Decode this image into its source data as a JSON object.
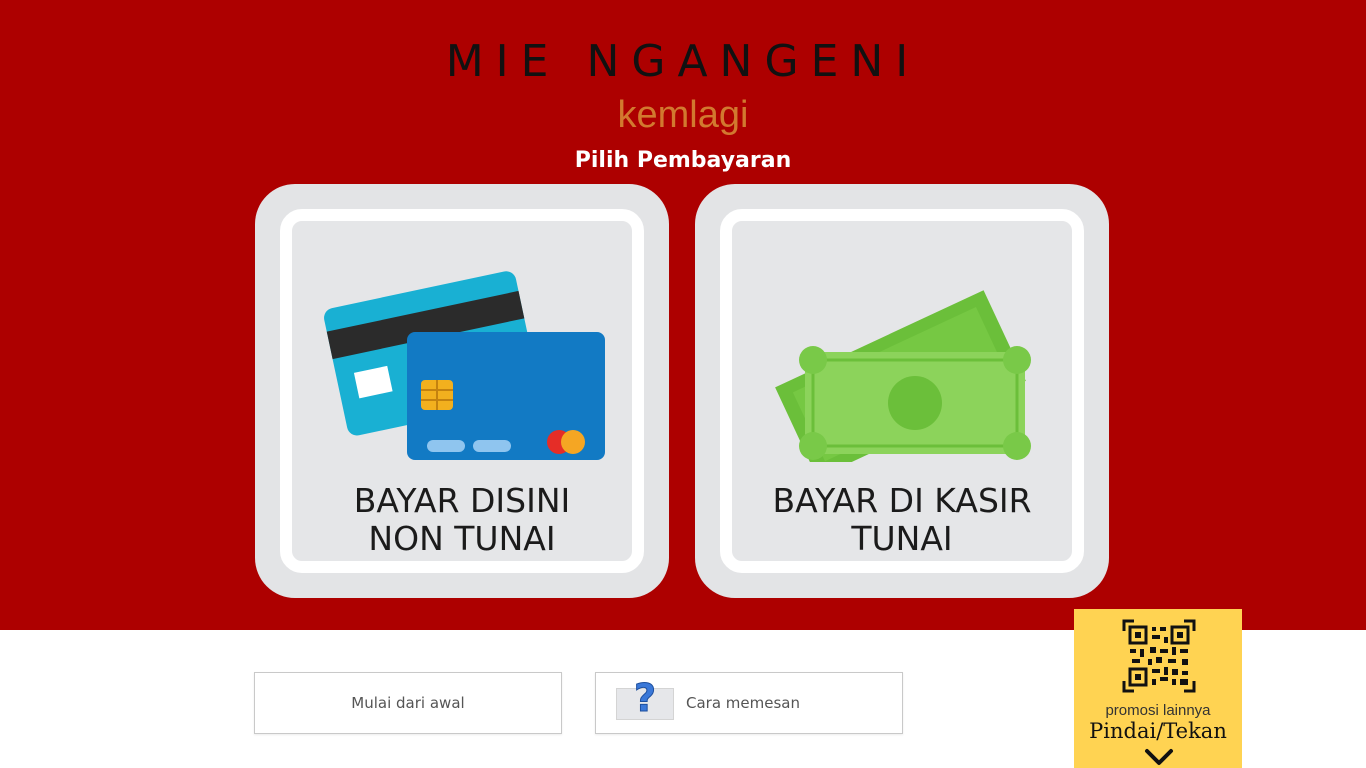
{
  "header": {
    "brand_title": "MIE NGANGENI",
    "brand_subtitle": "kemlagi",
    "section_title": "Pilih Pembayaran"
  },
  "payment_options": [
    {
      "line1": "BAYAR DISINI",
      "line2": "NON TUNAI",
      "icon": "credit-card-icon"
    },
    {
      "line1": "BAYAR DI KASIR",
      "line2": "TUNAI",
      "icon": "cash-icon"
    }
  ],
  "footer": {
    "restart_label": "Mulai dari awal",
    "howto_label": "Cara memesan",
    "howto_icon": "question-mark-icon"
  },
  "promo": {
    "text": "promosi lainnya",
    "action": "Pindai/Tekan",
    "icon": "qr-code-icon",
    "arrow_icon": "chevron-down-icon"
  },
  "colors": {
    "hero_background": "#ad0000",
    "subtitle": "#d2792f",
    "promo_background": "#ffd352",
    "card_background": "#e3e4e6"
  }
}
